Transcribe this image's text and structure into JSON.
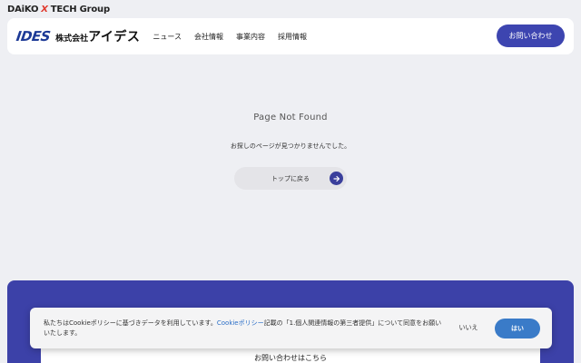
{
  "group_logo": {
    "prefix": "DAiKO",
    "x": "X",
    "suffix": "TECH Group"
  },
  "header": {
    "logo_mark": "IDES",
    "logo_small": "株式会社",
    "logo_big": "アイデス",
    "nav": [
      "ニュース",
      "会社情報",
      "事業内容",
      "採用情報"
    ],
    "contact_label": "お問い合わせ"
  },
  "main": {
    "title": "Page Not Found",
    "message": "お探しのページが見つかりませんでした。",
    "top_button_label": "トップに戻る"
  },
  "footer": {
    "contact_text": "お問い合わせはこちら"
  },
  "cookie": {
    "text_before": "私たちはCookieポリシーに基づきデータを利用しています。",
    "link_text": "Cookieポリシー",
    "text_after": "記載の「1.個人関連情報の第三者提供」について同意をお願いいたします。",
    "no_label": "いいえ",
    "yes_label": "はい"
  },
  "colors": {
    "accent": "#3d45b0",
    "footer": "#3c41a8",
    "cookie_yes": "#3a7bc8",
    "background": "#eeeff3"
  }
}
